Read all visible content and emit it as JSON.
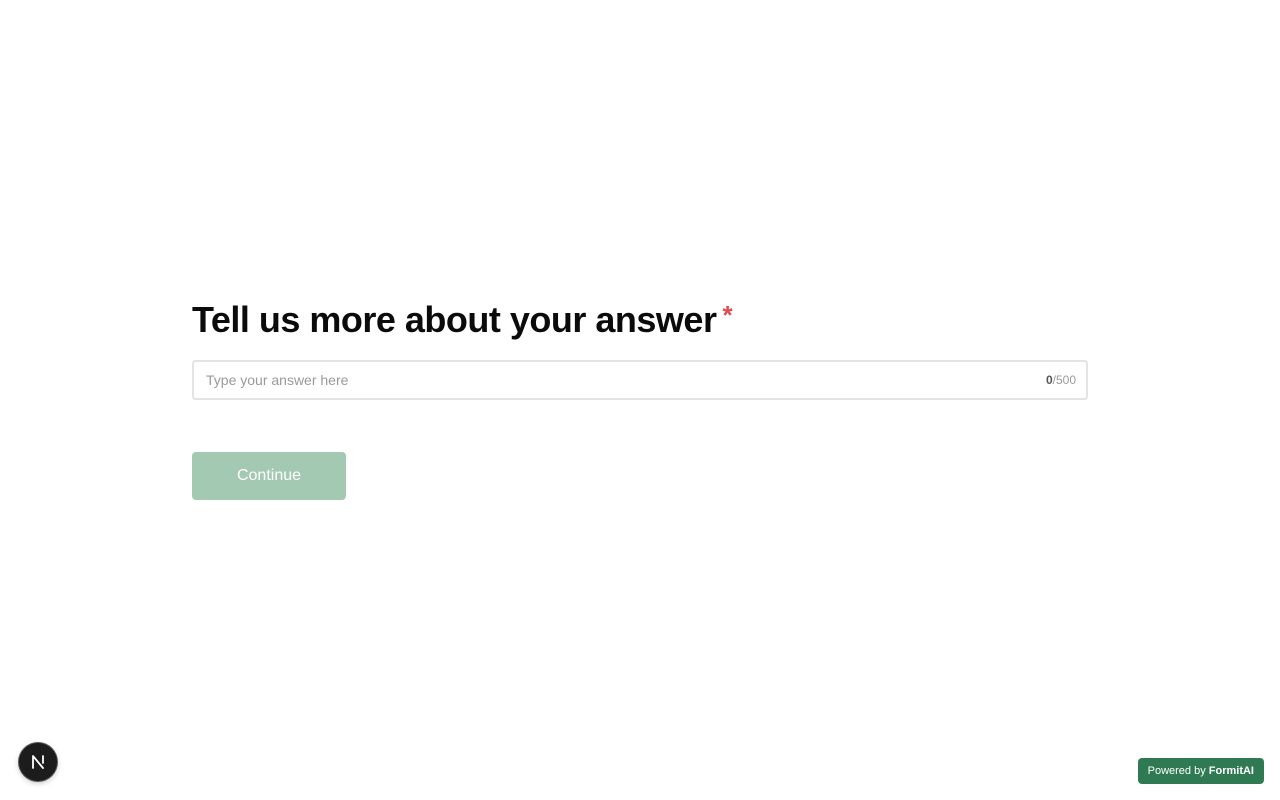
{
  "question": {
    "title": "Tell us more about your answer",
    "required_mark": "*"
  },
  "answer_field": {
    "placeholder": "Type your answer here",
    "value": "",
    "char_count": "0",
    "char_limit": "/500"
  },
  "actions": {
    "continue_label": "Continue",
    "continue_enabled": false
  },
  "footer": {
    "badge_prefix": "Powered by ",
    "badge_brand": "FormitAI",
    "badge_color": "#2f7a52"
  },
  "dev_badge": {
    "icon": "nextjs-icon",
    "letter": "N"
  },
  "colors": {
    "accent_disabled": "#a3c9b3",
    "required": "#e5484d"
  }
}
